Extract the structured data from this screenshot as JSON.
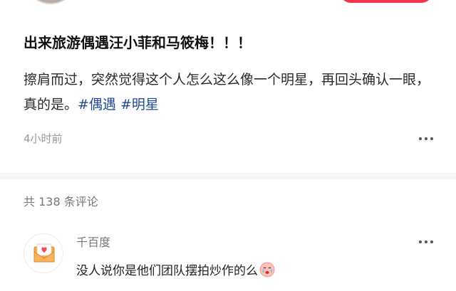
{
  "post": {
    "title": "出来旅游偶遇汪小菲和马筱梅！！！",
    "body_text": "擦肩而过，突然觉得这个人怎么这么像一个明星，再回头确认一眼，真的是。",
    "hashtags": [
      "#偶遇",
      "#明星"
    ],
    "time": "4小时前"
  },
  "comments_section": {
    "count_label": "共 138 条评论"
  },
  "comments": [
    {
      "author": "千百度",
      "text": "没人说你是他们团队摆拍炒作的么",
      "emoji_icon": "sad-crying-face-icon"
    }
  ],
  "colors": {
    "hashtag": "#1f4a94",
    "follow_button": "#f5334c",
    "muted_text": "#999999"
  },
  "icons": {
    "more": "more-dots-icon",
    "avatar": "envelope-heart-icon"
  }
}
